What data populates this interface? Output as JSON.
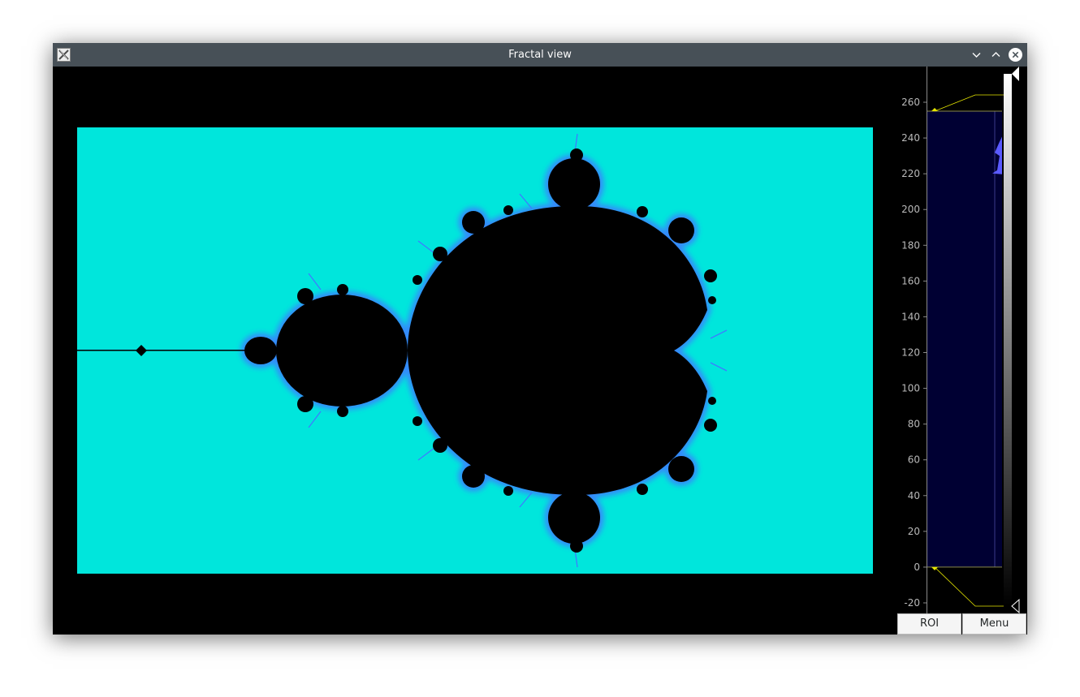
{
  "window": {
    "title": "Fractal view"
  },
  "icons": {
    "app": "x-logo-icon",
    "minimize": "chevron-down-icon",
    "maximize": "chevron-up-icon",
    "close": "close-icon"
  },
  "colors": {
    "background": "#00e6dc",
    "set": "#000000",
    "edge": "#3d7cff",
    "histogram_fill": "#000033",
    "histogram_peak": "#5a5aff",
    "levels_line": "#e6e600"
  },
  "histogram": {
    "axis_ticks": [
      "260",
      "240",
      "220",
      "200",
      "180",
      "160",
      "140",
      "120",
      "100",
      "80",
      "60",
      "40",
      "20",
      "0",
      "-20"
    ],
    "ylim": [
      -20,
      265
    ],
    "upper_level": 255,
    "lower_level": 0
  },
  "buttons": {
    "roi": "ROI",
    "menu": "Menu"
  }
}
